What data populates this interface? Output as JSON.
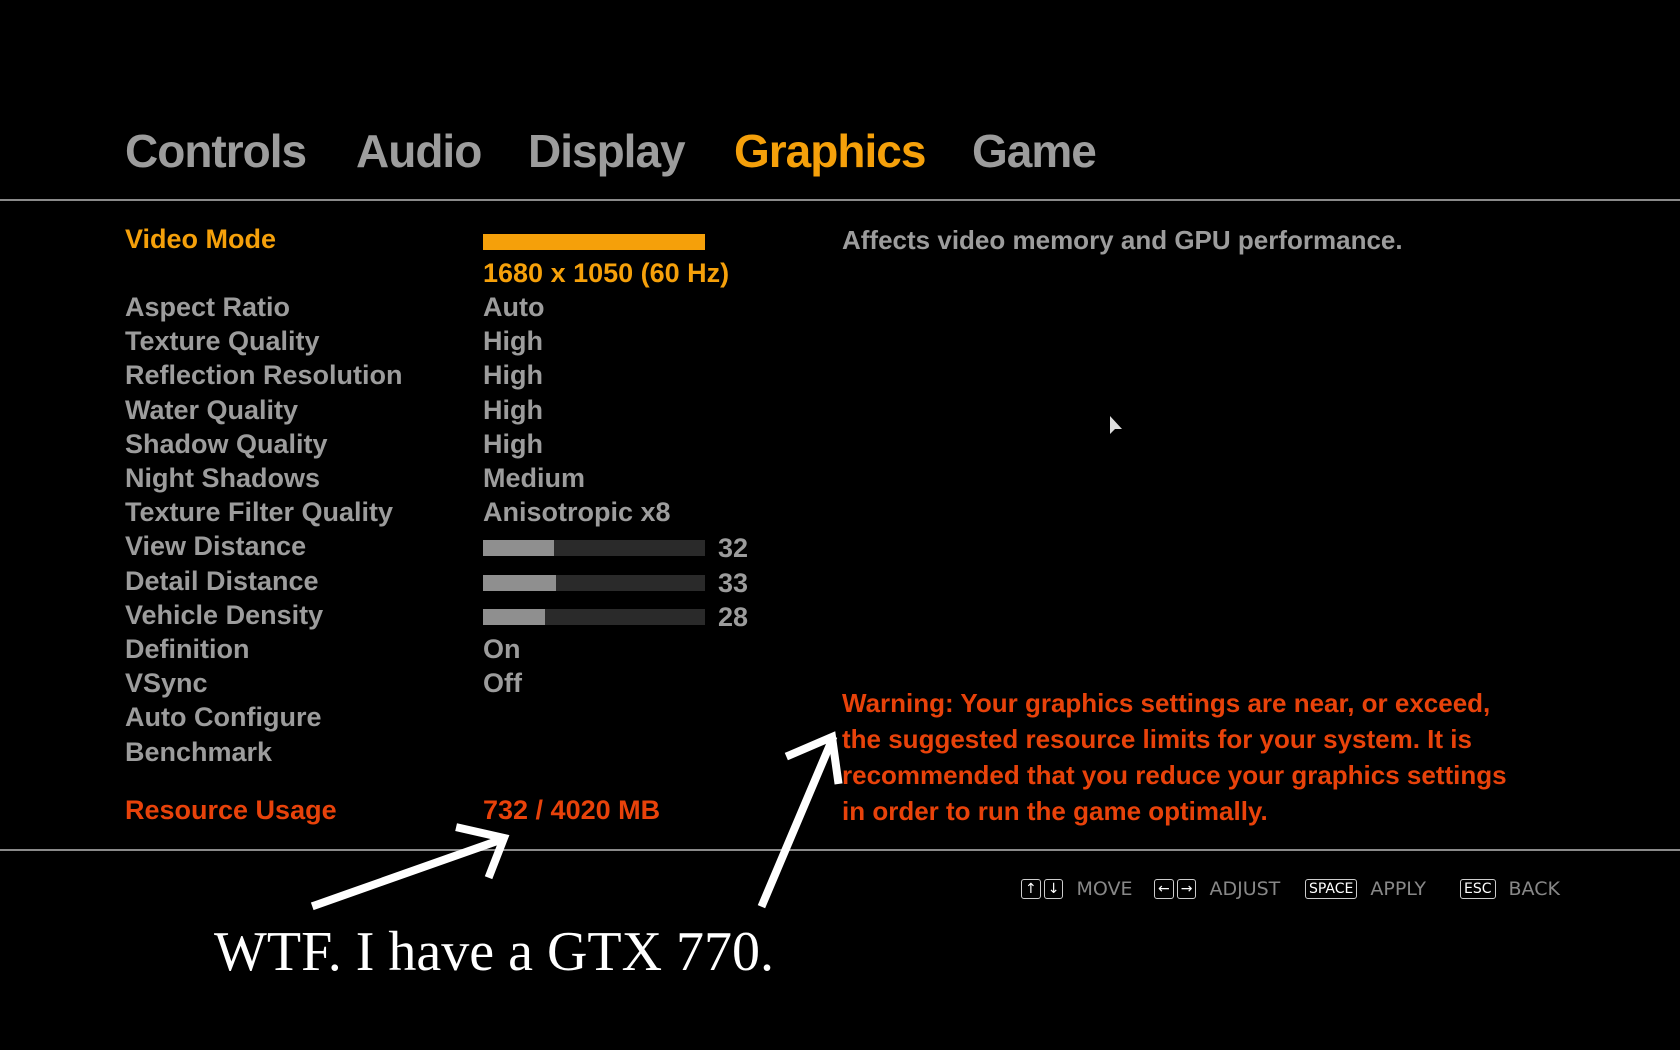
{
  "tabs": [
    {
      "label": "Controls",
      "active": false
    },
    {
      "label": "Audio",
      "active": false
    },
    {
      "label": "Display",
      "active": false
    },
    {
      "label": "Graphics",
      "active": true
    },
    {
      "label": "Game",
      "active": false
    }
  ],
  "settings": {
    "video_mode": {
      "label": "Video Mode",
      "value": "1680 x 1050 (60 Hz)"
    },
    "rows": [
      {
        "label": "Aspect Ratio",
        "value": "Auto"
      },
      {
        "label": "Texture Quality",
        "value": "High"
      },
      {
        "label": "Reflection Resolution",
        "value": "High"
      },
      {
        "label": "Water Quality",
        "value": "High"
      },
      {
        "label": "Shadow Quality",
        "value": "High"
      },
      {
        "label": "Night Shadows",
        "value": "Medium"
      },
      {
        "label": "Texture Filter Quality",
        "value": "Anisotropic x8"
      },
      {
        "label": "View Distance",
        "value": "32",
        "slider": 32
      },
      {
        "label": "Detail Distance",
        "value": "33",
        "slider": 33
      },
      {
        "label": "Vehicle Density",
        "value": "28",
        "slider": 28
      },
      {
        "label": "Definition",
        "value": "On"
      },
      {
        "label": "VSync",
        "value": "Off"
      },
      {
        "label": "Auto Configure",
        "value": ""
      },
      {
        "label": "Benchmark",
        "value": ""
      }
    ],
    "resource": {
      "label": "Resource Usage",
      "value": "732 / 4020 MB"
    }
  },
  "description": "Affects video memory and GPU performance.",
  "warning": [
    "Warning: Your graphics settings are near, or exceed,",
    "the suggested resource limits for your system. It is",
    "recommended that you reduce your graphics settings",
    "in order to run the game optimally."
  ],
  "footer": [
    {
      "keys": [
        "↑",
        "↓"
      ],
      "label": "MOVE"
    },
    {
      "keys": [
        "←",
        "→"
      ],
      "label": "ADJUST"
    },
    {
      "keys": [
        "SPACE"
      ],
      "label": "APPLY"
    },
    {
      "keys": [
        "ESC"
      ],
      "label": "BACK"
    }
  ],
  "annotation": "WTF.  I have a GTX 770.",
  "colors": {
    "accent": "#f5a00a",
    "warning": "#e8420a",
    "text": "#9c9c9c"
  }
}
